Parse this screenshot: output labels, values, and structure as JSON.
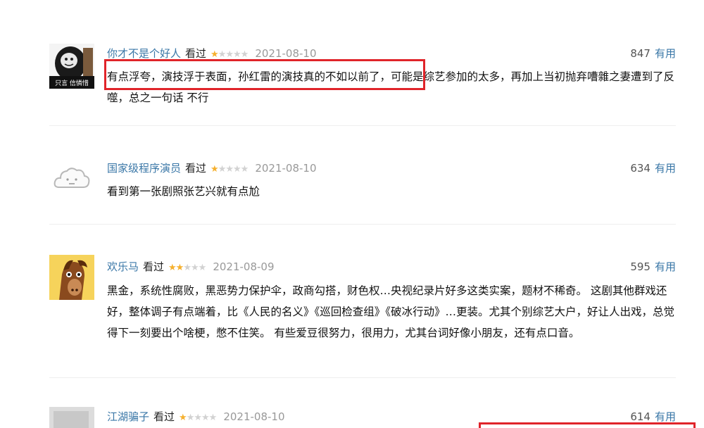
{
  "reviews": [
    {
      "username": "你才不是个好人",
      "status": "看过",
      "stars": 1,
      "date": "2021-08-10",
      "votes": "847",
      "useful_label": "有用",
      "text": "有点浮夸，演技浮于表面，孙红雷的演技真的不如以前了，可能是综艺参加的太多，再加上当初抛弃嘈雜之妻遭到了反噬，总之一句话 不行",
      "avatar_caption": "只言 信憐惜"
    },
    {
      "username": "国家级程序演员",
      "status": "看过",
      "stars": 1,
      "date": "2021-08-10",
      "votes": "634",
      "useful_label": "有用",
      "text": "看到第一张剧照张艺兴就有点尬"
    },
    {
      "username": "欢乐马",
      "status": "看过",
      "stars": 2,
      "date": "2021-08-09",
      "votes": "595",
      "useful_label": "有用",
      "text": "黑金，系统性腐败，黑恶势力保护伞，政商勾搭，财色权…央视纪录片好多这类实案，题材不稀奇。 这剧其他群戏还好，整体调子有点端着，比《人民的名义》《巡回检查组》《破冰行动》…更装。尤其个别综艺大户，好让人出戏，总觉得下一刻要出个啥梗，憋不住笑。 有些爱豆很努力，很用力，尤其台词好像小朋友，还有点口音。"
    },
    {
      "username": "江湖骗子",
      "status": "看过",
      "stars": 1,
      "date": "2021-08-10",
      "votes": "614",
      "useful_label": "有用",
      "text": ""
    }
  ],
  "colors": {
    "link": "#3a77a7",
    "star_on": "#f5b02e",
    "star_off": "#d2d2d2",
    "highlight": "#e0242a"
  },
  "icons": {
    "placeholder_avatar": "cloud-face-icon",
    "star": "star-icon"
  }
}
